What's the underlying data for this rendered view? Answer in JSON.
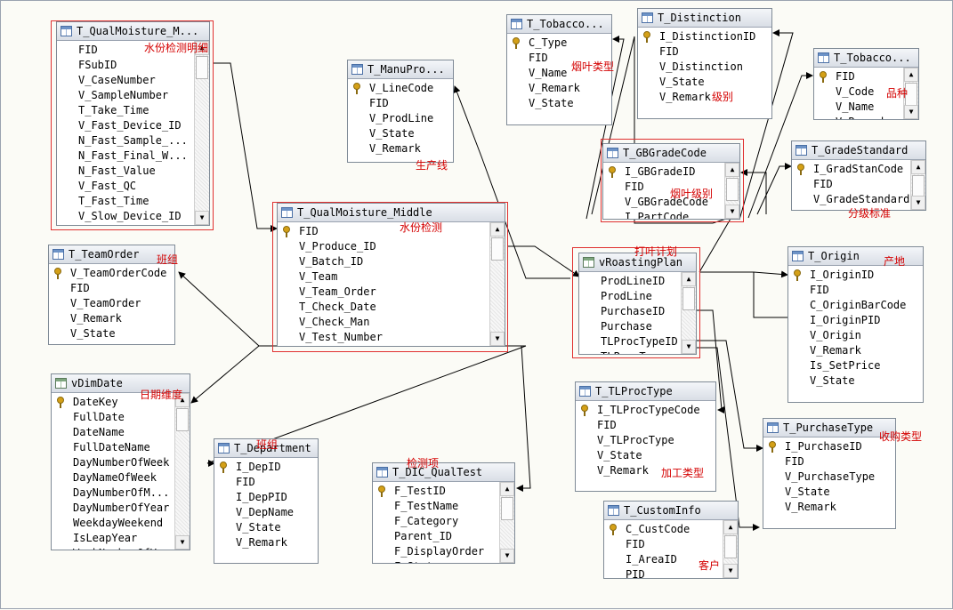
{
  "tables": [
    {
      "id": "qm_detail",
      "title": "T_QualMoisture_M...",
      "icon": "table-icon",
      "rows": [
        {
          "text": "FID",
          "key": false
        },
        {
          "text": "FSubID",
          "key": false
        },
        {
          "text": "V_CaseNumber",
          "key": false
        },
        {
          "text": "V_SampleNumber",
          "key": false
        },
        {
          "text": "T_Take_Time",
          "key": false
        },
        {
          "text": "V_Fast_Device_ID",
          "key": false
        },
        {
          "text": "N_Fast_Sample_...",
          "key": false
        },
        {
          "text": "N_Fast_Final_W...",
          "key": false
        },
        {
          "text": "N_Fast_Value",
          "key": false
        },
        {
          "text": "V_Fast_QC",
          "key": false
        },
        {
          "text": "T_Fast_Time",
          "key": false
        },
        {
          "text": "V_Slow_Device_ID",
          "key": false
        }
      ]
    },
    {
      "id": "manupro",
      "title": "T_ManuPro...",
      "icon": "table-icon",
      "rows": [
        {
          "text": "V_LineCode",
          "key": true
        },
        {
          "text": "FID",
          "key": false
        },
        {
          "text": "V_ProdLine",
          "key": false
        },
        {
          "text": "V_State",
          "key": false
        },
        {
          "text": "V_Remark",
          "key": false
        }
      ]
    },
    {
      "id": "tobacco1",
      "title": "T_Tobacco...",
      "icon": "table-icon",
      "rows": [
        {
          "text": "C_Type",
          "key": true
        },
        {
          "text": "FID",
          "key": false
        },
        {
          "text": "V_Name",
          "key": false
        },
        {
          "text": "V_Remark",
          "key": false
        },
        {
          "text": "V_State",
          "key": false
        }
      ]
    },
    {
      "id": "distinction",
      "title": "T_Distinction",
      "icon": "table-icon",
      "rows": [
        {
          "text": "I_DistinctionID",
          "key": true
        },
        {
          "text": "FID",
          "key": false
        },
        {
          "text": "V_Distinction",
          "key": false
        },
        {
          "text": "V_State",
          "key": false
        },
        {
          "text": "V_Remark",
          "key": false
        }
      ]
    },
    {
      "id": "tobacco2",
      "title": "T_Tobacco...",
      "icon": "table-icon",
      "rows": [
        {
          "text": "FID",
          "key": true
        },
        {
          "text": "V_Code",
          "key": false
        },
        {
          "text": "V_Name",
          "key": false
        },
        {
          "text": "V_Remark",
          "key": false
        }
      ]
    },
    {
      "id": "gbgrade",
      "title": "T_GBGradeCode",
      "icon": "table-icon",
      "rows": [
        {
          "text": "I_GBGradeID",
          "key": true
        },
        {
          "text": "FID",
          "key": false
        },
        {
          "text": "V_GBGradeCode",
          "key": false
        },
        {
          "text": "I_PartCode",
          "key": false
        }
      ]
    },
    {
      "id": "gradestd",
      "title": "T_GradeStandard",
      "icon": "table-icon",
      "rows": [
        {
          "text": "I_GradStanCode",
          "key": true
        },
        {
          "text": "FID",
          "key": false
        },
        {
          "text": "V_GradeStandard",
          "key": false
        }
      ]
    },
    {
      "id": "qm_middle",
      "title": "T_QualMoisture_Middle",
      "icon": "table-icon",
      "rows": [
        {
          "text": "FID",
          "key": true
        },
        {
          "text": "V_Produce_ID",
          "key": false
        },
        {
          "text": "V_Batch_ID",
          "key": false
        },
        {
          "text": "V_Team",
          "key": false
        },
        {
          "text": "V_Team_Order",
          "key": false
        },
        {
          "text": "T_Check_Date",
          "key": false
        },
        {
          "text": "V_Check_Man",
          "key": false
        },
        {
          "text": "V_Test_Number",
          "key": false
        }
      ]
    },
    {
      "id": "teamorder",
      "title": "T_TeamOrder",
      "icon": "table-icon",
      "rows": [
        {
          "text": "V_TeamOrderCode",
          "key": true
        },
        {
          "text": "FID",
          "key": false
        },
        {
          "text": "V_TeamOrder",
          "key": false
        },
        {
          "text": "V_Remark",
          "key": false
        },
        {
          "text": "V_State",
          "key": false
        }
      ]
    },
    {
      "id": "roasting",
      "title": "vRoastingPlan",
      "icon": "view-icon",
      "rows": [
        {
          "text": "ProdLineID",
          "key": false
        },
        {
          "text": "ProdLine",
          "key": false
        },
        {
          "text": "PurchaseID",
          "key": false
        },
        {
          "text": "Purchase",
          "key": false
        },
        {
          "text": "TLProcTypeID",
          "key": false
        },
        {
          "text": "TLProcType",
          "key": false
        }
      ]
    },
    {
      "id": "origin",
      "title": "T_Origin",
      "icon": "table-icon",
      "rows": [
        {
          "text": "I_OriginID",
          "key": true
        },
        {
          "text": "FID",
          "key": false
        },
        {
          "text": "C_OriginBarCode",
          "key": false
        },
        {
          "text": "I_OriginPID",
          "key": false
        },
        {
          "text": "V_Origin",
          "key": false
        },
        {
          "text": "V_Remark",
          "key": false
        },
        {
          "text": "Is_SetPrice",
          "key": false
        },
        {
          "text": "V_State",
          "key": false
        }
      ]
    },
    {
      "id": "dimdate",
      "title": "vDimDate",
      "icon": "view-icon",
      "rows": [
        {
          "text": "DateKey",
          "key": true
        },
        {
          "text": "FullDate",
          "key": false
        },
        {
          "text": "DateName",
          "key": false
        },
        {
          "text": "FullDateName",
          "key": false
        },
        {
          "text": "DayNumberOfWeek",
          "key": false
        },
        {
          "text": "DayNameOfWeek",
          "key": false
        },
        {
          "text": "DayNumberOfM...",
          "key": false
        },
        {
          "text": "DayNumberOfYear",
          "key": false
        },
        {
          "text": "WeekdayWeekend",
          "key": false
        },
        {
          "text": "IsLeapYear",
          "key": false
        },
        {
          "text": "WeekNumberOfY...",
          "key": false
        }
      ]
    },
    {
      "id": "tlproctype",
      "title": "T_TLProcType",
      "icon": "table-icon",
      "rows": [
        {
          "text": "I_TLProcTypeCode",
          "key": true
        },
        {
          "text": "FID",
          "key": false
        },
        {
          "text": "V_TLProcType",
          "key": false
        },
        {
          "text": "V_State",
          "key": false
        },
        {
          "text": "V_Remark",
          "key": false
        }
      ]
    },
    {
      "id": "purchasetype",
      "title": "T_PurchaseType",
      "icon": "table-icon",
      "rows": [
        {
          "text": "I_PurchaseID",
          "key": true
        },
        {
          "text": "FID",
          "key": false
        },
        {
          "text": "V_PurchaseType",
          "key": false
        },
        {
          "text": "V_State",
          "key": false
        },
        {
          "text": "V_Remark",
          "key": false
        }
      ]
    },
    {
      "id": "department",
      "title": "T_Department",
      "icon": "table-icon",
      "rows": [
        {
          "text": "I_DepID",
          "key": true
        },
        {
          "text": "FID",
          "key": false
        },
        {
          "text": "I_DepPID",
          "key": false
        },
        {
          "text": "V_DepName",
          "key": false
        },
        {
          "text": "V_State",
          "key": false
        },
        {
          "text": "V_Remark",
          "key": false
        }
      ]
    },
    {
      "id": "dicqualtest",
      "title": "T_DIC_QualTest",
      "icon": "table-icon",
      "rows": [
        {
          "text": "F_TestID",
          "key": true
        },
        {
          "text": "F_TestName",
          "key": false
        },
        {
          "text": "F_Category",
          "key": false
        },
        {
          "text": "Parent_ID",
          "key": false
        },
        {
          "text": "F_DisplayOrder",
          "key": false
        },
        {
          "text": "F_State",
          "key": false
        }
      ]
    },
    {
      "id": "custominfo",
      "title": "T_CustomInfo",
      "icon": "table-icon",
      "rows": [
        {
          "text": "C_CustCode",
          "key": true
        },
        {
          "text": "FID",
          "key": false
        },
        {
          "text": "I_AreaID",
          "key": false
        },
        {
          "text": "PID",
          "key": false
        }
      ]
    }
  ],
  "annotations": [
    {
      "id": "ann_qm_detail",
      "text": "水份检测明细"
    },
    {
      "id": "ann_tobacco_type",
      "text": "烟叶类型"
    },
    {
      "id": "ann_grade",
      "text": "级别"
    },
    {
      "id": "ann_variety",
      "text": "品种"
    },
    {
      "id": "ann_prodline",
      "text": "生产线"
    },
    {
      "id": "ann_leaf_grade",
      "text": "烟叶级别"
    },
    {
      "id": "ann_grade_std",
      "text": "分级标准"
    },
    {
      "id": "ann_qm",
      "text": "水份检测"
    },
    {
      "id": "ann_roasting",
      "text": "打叶计划"
    },
    {
      "id": "ann_shift",
      "text": "班组"
    },
    {
      "id": "ann_origin",
      "text": "产地"
    },
    {
      "id": "ann_date",
      "text": "日期维度"
    },
    {
      "id": "ann_team",
      "text": "班组"
    },
    {
      "id": "ann_purchase",
      "text": "收购类型"
    },
    {
      "id": "ann_process",
      "text": "加工类型"
    },
    {
      "id": "ann_test",
      "text": "检测项"
    },
    {
      "id": "ann_customer",
      "text": "客户"
    }
  ]
}
